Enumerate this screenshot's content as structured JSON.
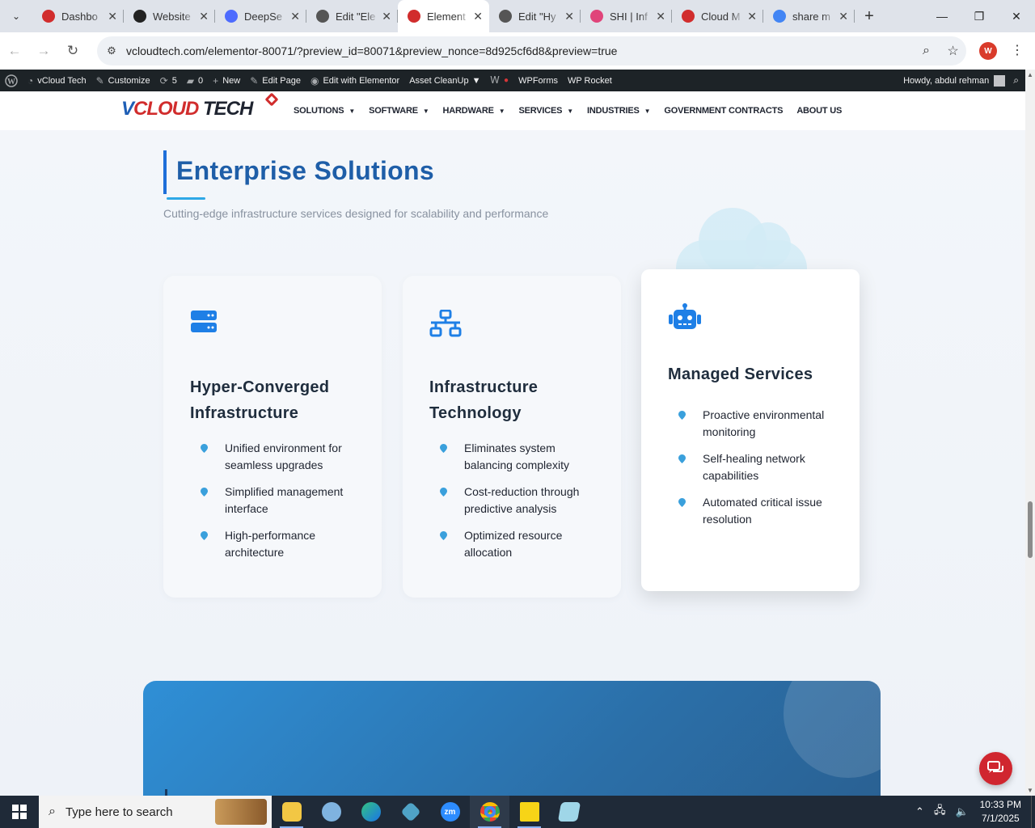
{
  "browser": {
    "tabs": [
      {
        "title": "Dashbo",
        "favicon_color": "#d12d2d",
        "active": false
      },
      {
        "title": "Website",
        "favicon_color": "#222222",
        "active": false
      },
      {
        "title": "DeepSe",
        "favicon_color": "#4d6bfe",
        "active": false
      },
      {
        "title": "Edit \"Ele",
        "favicon_color": "#555555",
        "active": false
      },
      {
        "title": "Element",
        "favicon_color": "#d12d2d",
        "active": true
      },
      {
        "title": "Edit \"Hy",
        "favicon_color": "#555555",
        "active": false
      },
      {
        "title": "SHI | Inf",
        "favicon_color": "#e0447a",
        "active": false
      },
      {
        "title": "Cloud M",
        "favicon_color": "#d12d2d",
        "active": false
      },
      {
        "title": "share m",
        "favicon_color": "#4285f4",
        "active": false
      }
    ],
    "close_glyph": "✕",
    "url": "vcloudtech.com/elementor-80071/?preview_id=80071&preview_nonce=8d925cf6d8&preview=true",
    "profile_initial": "W"
  },
  "wp_admin_bar": {
    "site_name": "vCloud Tech",
    "customize": "Customize",
    "updates": "5",
    "comments": "0",
    "new": "New",
    "edit_page": "Edit Page",
    "edit_elementor": "Edit with Elementor",
    "asset_cleanup": "Asset CleanUp",
    "wpforms": "WPForms",
    "wp_rocket": "WP Rocket",
    "howdy": "Howdy, abdul rehman"
  },
  "site": {
    "logo": {
      "v": "V",
      "cloud": "CLOUD",
      "tech": " TECH"
    },
    "menu": [
      {
        "label": "SOLUTIONS",
        "caret": true
      },
      {
        "label": "SOFTWARE",
        "caret": true
      },
      {
        "label": "HARDWARE",
        "caret": true
      },
      {
        "label": "SERVICES",
        "caret": true
      },
      {
        "label": "INDUSTRIES",
        "caret": true
      },
      {
        "label": "GOVERNMENT CONTRACTS",
        "caret": false
      },
      {
        "label": "ABOUT US",
        "caret": false
      }
    ],
    "section_title": "Enterprise Solutions",
    "section_subtitle": "Cutting-edge infrastructure services designed for scalability and performance",
    "cards": [
      {
        "icon": "server-icon",
        "title": "Hyper-Converged Infrastructure",
        "items": [
          "Unified environment for seamless upgrades",
          "Simplified management interface",
          "High-performance architecture"
        ]
      },
      {
        "icon": "network-icon",
        "title": "Infrastructure Technology",
        "items": [
          "Eliminates system balancing complexity",
          "Cost-reduction through predictive analysis",
          "Optimized resource allocation"
        ]
      },
      {
        "icon": "robot-icon",
        "title": "Managed Services",
        "items": [
          "Proactive environmental monitoring",
          "Self-healing network capabilities",
          "Automated critical issue resolution"
        ]
      }
    ],
    "accent_color": "#1e6fd9",
    "chat_color": "#d0262f"
  },
  "taskbar": {
    "search_placeholder": "Type here to search",
    "time": "10:33 PM",
    "date": "7/1/2025"
  }
}
